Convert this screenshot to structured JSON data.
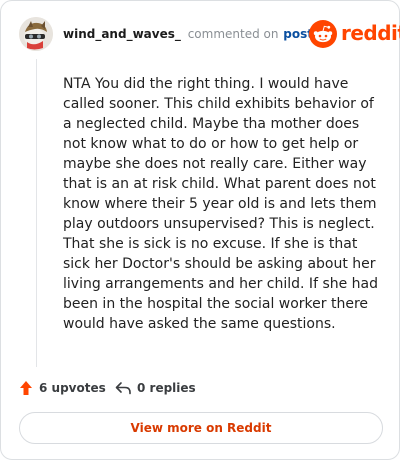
{
  "header": {
    "username": "wind_and_waves_",
    "action_text": "commented on",
    "post_link": "post",
    "brand_name": "reddit",
    "brand_color": "#ff4500"
  },
  "comment": {
    "body": "NTA You did the right thing. I would have called sooner. This child exhibits behavior of a neglected child. Maybe tha mother does not know what to do or how to get help or maybe she does not really care. Either way that is an at risk child. What parent does not know where their 5 year old is and lets them play outdoors unsupervised? This is neglect. That she is sick is no excuse. If she is that sick her Doctor's should be asking about her living arrangements and her child. If she had been in the hospital the social worker there would have asked the same questions."
  },
  "actions": {
    "upvotes_label": "6 upvotes",
    "upvote_icon": "upvote-arrow-icon",
    "replies_label": "0 replies",
    "reply_icon": "reply-arrow-icon"
  },
  "footer": {
    "view_more_label": "View more on Reddit"
  }
}
